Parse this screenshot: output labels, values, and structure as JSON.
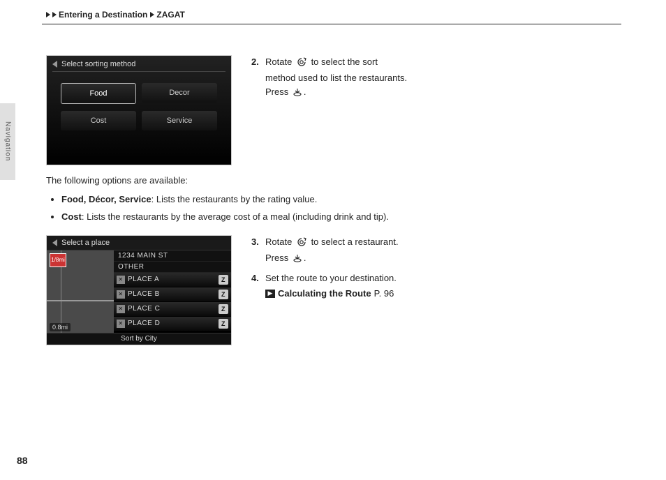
{
  "breadcrumb": {
    "section": "Entering a Destination",
    "sub": "ZAGAT"
  },
  "side_tab": "Navigation",
  "page_number": "88",
  "screen1": {
    "title": "Select sorting method",
    "cells": [
      "Food",
      "Decor",
      "Cost",
      "Service"
    ],
    "selected": 0
  },
  "step2": {
    "num": "2.",
    "line1": "Rotate",
    "line1b": "to select the sort",
    "line2": "method used to list the restaurants.",
    "line3a": "Press",
    "line3b": "."
  },
  "options_intro": "The following options are available:",
  "options": [
    {
      "bold": "Food, Décor, Service",
      "rest": ": Lists the restaurants by the rating value."
    },
    {
      "bold": "Cost",
      "rest": ": Lists the restaurants by the average cost of a meal (including drink and tip)."
    }
  ],
  "screen2": {
    "title": "Select a place",
    "addr1": "1234 MAIN ST",
    "addr2": "OTHER",
    "distance": "0.8mi",
    "marker": "1/8mi",
    "rows": [
      "PLACE A",
      "PLACE B",
      "PLACE C",
      "PLACE D"
    ],
    "footer": "Sort by City"
  },
  "step3": {
    "num": "3.",
    "line1a": "Rotate",
    "line1b": "to select a restaurant.",
    "line2a": "Press",
    "line2b": "."
  },
  "step4": {
    "num": "4.",
    "text": "Set the route to your destination.",
    "link_label": "Calculating the Route",
    "link_page": "P. 96"
  }
}
